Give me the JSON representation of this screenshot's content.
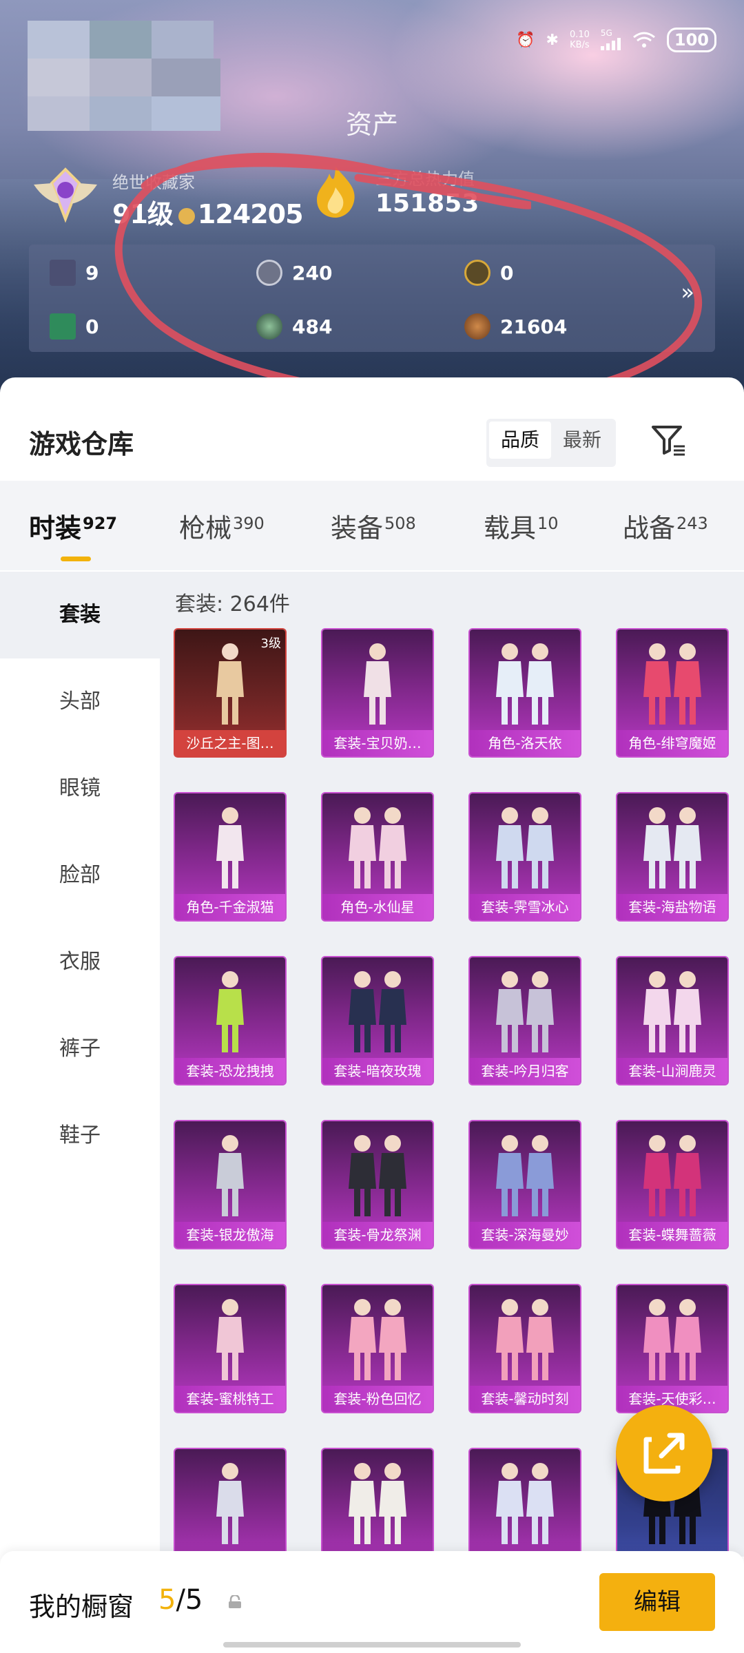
{
  "status_bar": {
    "net_speed": "0.10",
    "net_unit": "KB/s",
    "signal": "5G",
    "battery": "100"
  },
  "header": {
    "title": "资产"
  },
  "profile": {
    "rank_sub": "绝世收藏家",
    "rank_level": "91级",
    "coins": "124205",
    "fire_sub": "三方总热力值",
    "fire_value": "151853"
  },
  "assets": [
    {
      "icon": "card-icon",
      "value": "9"
    },
    {
      "icon": "silver-coin-icon",
      "value": "240"
    },
    {
      "icon": "gold-coin-icon",
      "value": "0"
    },
    {
      "icon": "green-card-icon",
      "value": "0"
    },
    {
      "icon": "green-orb-icon",
      "value": "484"
    },
    {
      "icon": "bronze-coin-icon",
      "value": "21604"
    }
  ],
  "more_symbol": "»",
  "sheet": {
    "title": "游戏仓库",
    "sort": [
      "品质",
      "最新"
    ]
  },
  "tabs": [
    {
      "label": "时装",
      "count": "927"
    },
    {
      "label": "枪械",
      "count": "390"
    },
    {
      "label": "装备",
      "count": "508"
    },
    {
      "label": "载具",
      "count": "10"
    },
    {
      "label": "战备",
      "count": "243"
    }
  ],
  "sidebar": [
    "套装",
    "头部",
    "眼镜",
    "脸部",
    "衣服",
    "裤子",
    "鞋子"
  ],
  "grid": {
    "count_label": "套装: 264件",
    "items": [
      {
        "name": "沙丘之主-图…",
        "level": "3级"
      },
      {
        "name": "套装-宝贝奶…"
      },
      {
        "name": "角色-洛天依"
      },
      {
        "name": "角色-绯穹魔姬"
      },
      {
        "name": "角色-千金淑猫"
      },
      {
        "name": "角色-水仙星"
      },
      {
        "name": "套装-霁雪冰心"
      },
      {
        "name": "套装-海盐物语"
      },
      {
        "name": "套装-恐龙拽拽"
      },
      {
        "name": "套装-暗夜玫瑰"
      },
      {
        "name": "套装-吟月归客"
      },
      {
        "name": "套装-山涧鹿灵"
      },
      {
        "name": "套装-银龙傲海"
      },
      {
        "name": "套装-骨龙祭渊"
      },
      {
        "name": "套装-深海曼妙"
      },
      {
        "name": "套装-蝶舞蔷薇"
      },
      {
        "name": "套装-蜜桃特工"
      },
      {
        "name": "套装-粉色回忆"
      },
      {
        "name": "套装-馨动时刻"
      },
      {
        "name": "套装-天使彩…"
      },
      {
        "name": ""
      },
      {
        "name": ""
      },
      {
        "name": ""
      },
      {
        "name": ""
      }
    ]
  },
  "bottom_bar": {
    "label": "我的橱窗",
    "count_current": "5",
    "count_total": "/5",
    "edit": "编辑"
  },
  "colors": {
    "accent": "#f4b00f",
    "card_purple": "#b839c4",
    "card_red": "#d3433e",
    "annotation": "#e0505e"
  }
}
